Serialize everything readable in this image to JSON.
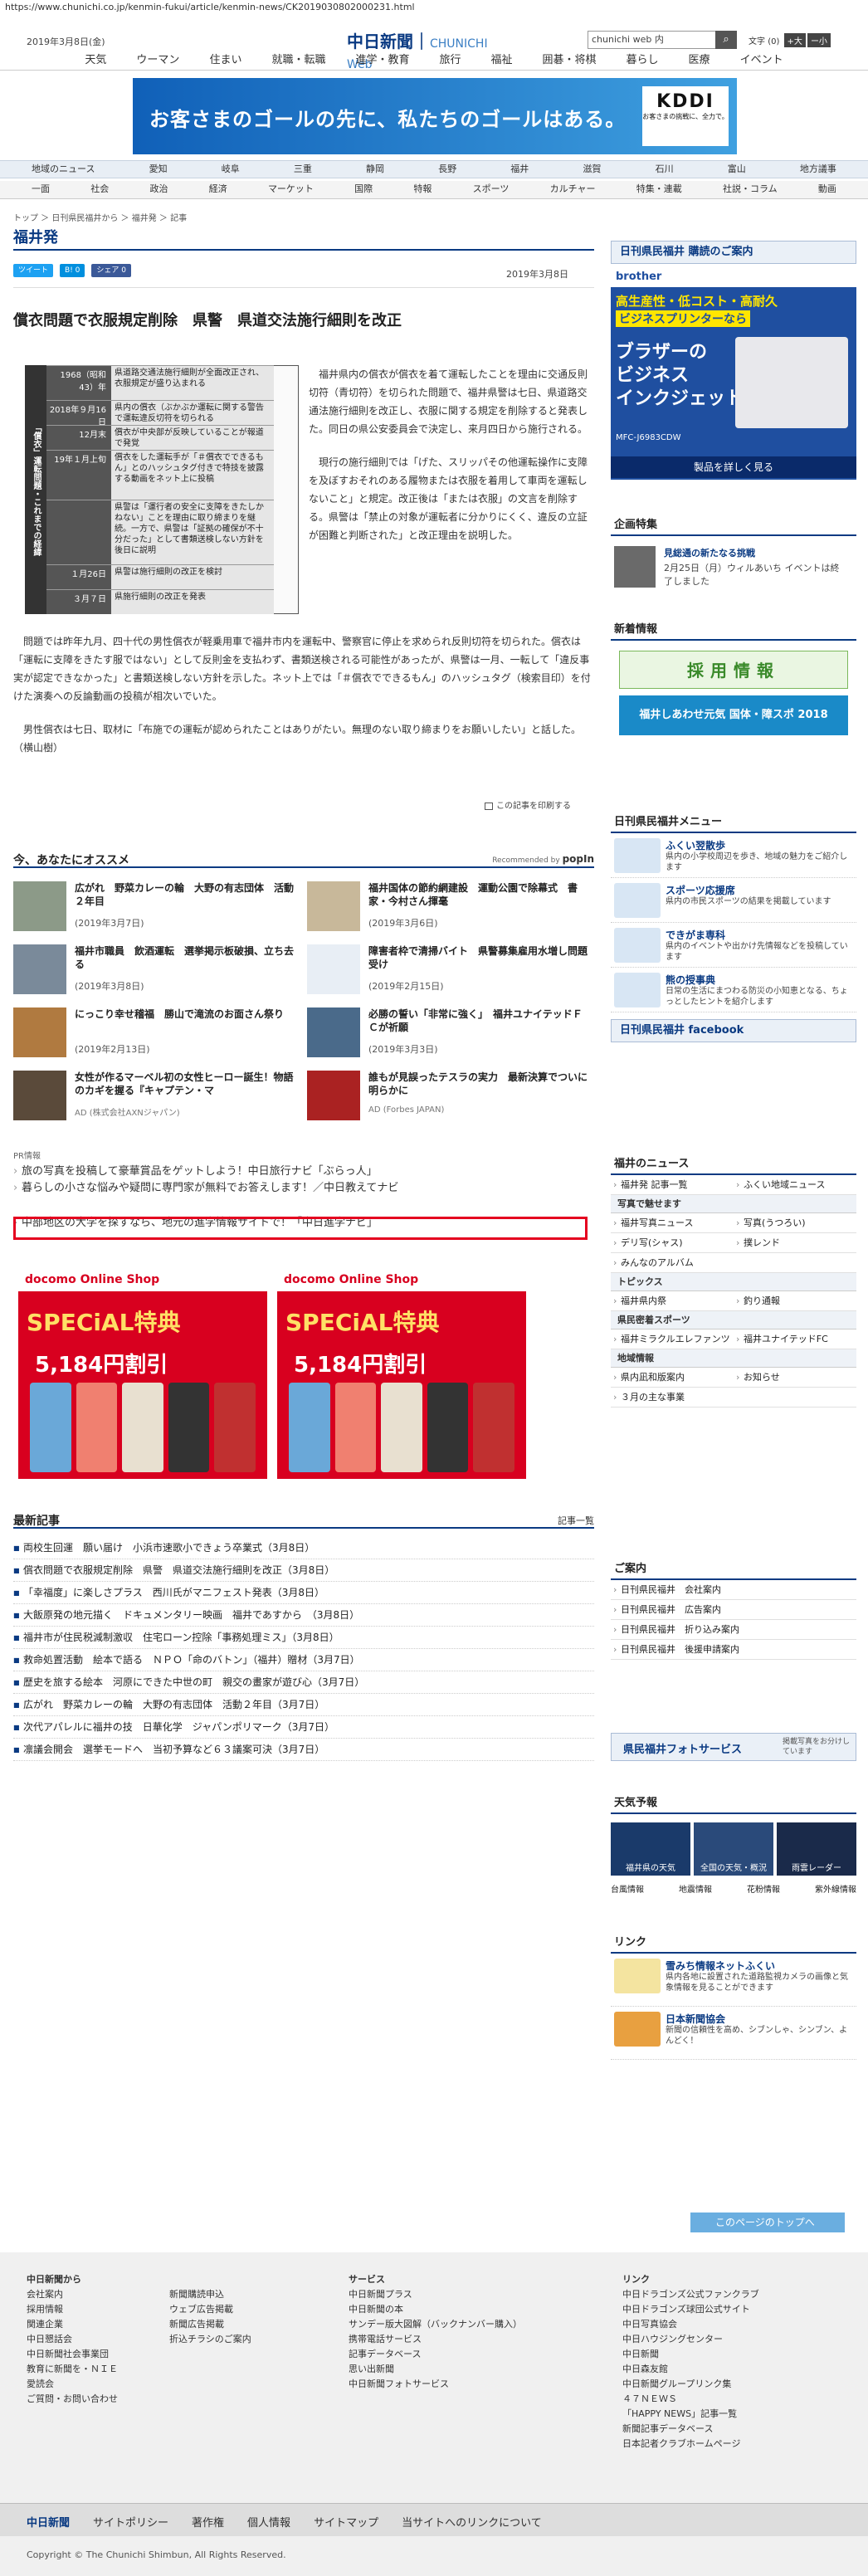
{
  "browser": {
    "url": "https://www.chunichi.co.jp/kenmin-fukui/article/kenmin-news/CK2019030802000231.html"
  },
  "header": {
    "date": "2019年3月8日(金)",
    "logo_main": "中日新聞",
    "logo_sub": "CHUNICHI Web",
    "search_value": "chunichi web 内",
    "search_icon": "search-icon",
    "font_label": "文字",
    "font_reset": "(0)",
    "font_plus": "+大",
    "font_minus": "ー小"
  },
  "nav1": [
    "天気",
    "ウーマン",
    "住まい",
    "就職・転職",
    "進学・教育",
    "旅行",
    "福祉",
    "囲碁・将棋",
    "暮らし",
    "医療",
    "イベント"
  ],
  "ad_top": {
    "text": "お客さまのゴールの先に、私たちのゴールはある。",
    "brand": "KDDI",
    "brand_sub": "お客さまの挑戦に、全力で。"
  },
  "nav2": [
    "地域のニュース",
    "愛知",
    "岐阜",
    "三重",
    "静岡",
    "長野",
    "福井",
    "滋賀",
    "石川",
    "富山",
    "地方議事"
  ],
  "nav3": [
    "一面",
    "社会",
    "政治",
    "経済",
    "マーケット",
    "国際",
    "特報",
    "スポーツ",
    "カルチャー",
    "特集・連載",
    "社説・コラム",
    "動画"
  ],
  "breadcrumb": "トップ ＞ 日刊県民福井から ＞ 福井発 ＞ 記事",
  "section_title": "福井発",
  "social": {
    "tweet": "ツイート",
    "hatena": "B! 0",
    "share": "シェア 0"
  },
  "article": {
    "date": "2019年3月8日",
    "headline": "償衣問題で衣服規定削除　県警　県道交法施行細則を改正",
    "timeline_title": "「償衣」運転問題・これまでの経緯",
    "timeline": [
      {
        "date": "1968（昭和43）年",
        "text": "県道路交通法施行細則が全面改正され、衣服規定が盛り込まれる"
      },
      {
        "date": "2018年９月16日",
        "text": "県内の償衣（ぶかぶか運転に関する警告で運転違反切符を切られる"
      },
      {
        "date": "12月末",
        "text": "償衣が中央部が反映していることが報道で発覚"
      },
      {
        "date": "19年１月上旬",
        "text": "償衣をした運転手が「＃償衣でできるもん」とのハッシュタグ付きで特技を披露する動画をネット上に投稿"
      },
      {
        "date": "",
        "text": "県警は「運行者の安全に支障をきたしかねない」ことを理由に取り締まりを継続。一方で、県警は「証拠の確保が不十分だった」として書類送検しない方針を後日に説明"
      },
      {
        "date": "１月26日",
        "text": "県警は施行細則の改正を検討"
      },
      {
        "date": "３月７日",
        "text": "県施行細則の改正を発表"
      }
    ],
    "paragraphs": [
      "福井県内の償衣が償衣を着て運転したことを理由に交通反則切符（青切符）を切られた問題で、福井県警は七日、県道路交通法施行細則を改正し、衣服に関する規定を削除すると発表した。同日の県公安委員会で決定し、来月四日から施行される。",
      "現行の施行細則では「げた、スリッパその他運転操作に支障を及ぼすおそれのある履物または衣服を着用して車両を運転しないこと」と規定。改正後は「または衣服」の文言を削除する。県警は「禁止の対象が運転者に分かりにくく、違反の立証が困難と判断された」と改正理由を説明した。",
      "問題では昨年九月、四十代の男性償衣が軽乗用車で福井市内を運転中、警察官に停止を求められ反則切符を切られた。償衣は「運転に支障をきたす服ではない」として反則金を支払わず、書類送検される可能性があったが、県警は一月、一転して「違反事実が認定できなかった」と書類送検しない方針を示した。ネット上では「＃償衣でできるもん」のハッシュタグ（検索目印）を付けた演奏への反論動画の投稿が相次いでいた。",
      "男性償衣は七日、取材に「布施での運転が認められたことはありがたい。無理のない取り締まりをお願いしたい」と話した。　（横山樹）"
    ],
    "print_label": "この記事を印刷する"
  },
  "recommend": {
    "title": "今、あなたにオススメ",
    "powered": "Recommended by",
    "brand": "popIn",
    "items": [
      {
        "text": "広がれ　野菜カレーの輪　大野の有志団体　活動２年目",
        "date": "(2019年3月7日)"
      },
      {
        "text": "福井国体の節約網建設　運動公園で除幕式　書家・今村さん揮毫",
        "date": "(2019年3月6日)"
      },
      {
        "text": "福井市職員　飲酒運転　選挙掲示板破損、立ち去る",
        "date": "(2019年3月8日)"
      },
      {
        "text": "障害者枠で清掃バイト　県警募集雇用水増し問題受け",
        "date": "(2019年2月15日)"
      },
      {
        "text": "にっこり幸せ稽福　勝山で滝流のお面さん祭り",
        "date": "(2019年2月13日)"
      },
      {
        "text": "必勝の誓い「非常に強く」　福井ユナイテッドＦＣが祈願",
        "date": "(2019年3月3日)"
      },
      {
        "text": "女性が作るマーベル初の女性ヒーロー誕生！物語のカギを握る『キャプテン・マ",
        "date": "AD (株式会社AXNジャパン)"
      },
      {
        "text": "誰もが見誤ったテスラの実力　最新決算でついに明らかに",
        "date": "AD (Forbes JAPAN)"
      }
    ]
  },
  "pr": {
    "label": "PR情報",
    "items": [
      "旅の写真を投稿して豪華賞品をゲットしよう！中日旅行ナビ「ぶらっ人」",
      "暮らしの小さな悩みや疑問に専門家が無料でお答えします！／中日教えてナビ",
      "中部地区の大学を探すなら、地元の進学情報サイトで！「中日進学ナビ」"
    ]
  },
  "docomo": {
    "brand": "docomo Online Shop",
    "big": "SPECiAL特典",
    "price": "5,184円割引"
  },
  "latest": {
    "title": "最新記事",
    "more": "記事一覧",
    "items": [
      "両校生回運　願い届け　小浜市速歌小できょう卒業式（3月8日）",
      "償衣問題で衣服規定削除　県警　県道交法施行細則を改正（3月8日）",
      "「幸福度」に楽しさプラス　西川氏がマニフェスト発表（3月8日）",
      "大飯原発の地元描く　ドキュメンタリー映画　福井であすから　（3月8日）",
      "福井市が住民税減制激収　住宅ローン控除「事務処理ミス」（3月8日）",
      "救命処置活動　絵本で語る　ＮＰＯ「命のバトン」（福井）贈材（3月7日）",
      "歴史を旅する絵本　河原にできた中世の町　親交の畫家が遊び心（3月7日）",
      "広がれ　野菜カレーの輪　大野の有志団体　活動２年目（3月7日）",
      "次代アパレルに福井の技　日華化学　ジャパンポリマーク（3月7日）",
      "凛議会開会　選挙モードへ　当初予算など６３議案可決（3月7日）"
    ]
  },
  "sidebar": {
    "subscribe": "日刊県民福井 購読のご案内",
    "brother": {
      "brand": "brother",
      "line1": "高生産性・低コスト・高耐久",
      "line2": "ビジネスプリンターなら",
      "line3": "ブラザーの",
      "line4": "ビジネス",
      "line5": "インクジェット",
      "model": "MFC-J6983CDW",
      "more": "製品を詳しく見る"
    },
    "feature": {
      "title": "企画特集",
      "item_title": "見総通の新たなる挑戦",
      "item_text": "2月25日（月）ウィルあいち イベントは終了しました"
    },
    "jobs": {
      "title": "新着情報",
      "banner1": "採用情報",
      "banner2": "福井しあわせ元気 国体・障スポ 2018"
    },
    "menu": {
      "title": "日刊県民福井メニュー",
      "items": [
        {
          "t": "ふくい翌散歩",
          "d": "県内の小学校周辺を歩き、地域の魅力をご紹介します"
        },
        {
          "t": "スポーツ応援席",
          "d": "県内の市民スポーツの結果を掲載しています"
        },
        {
          "t": "できがま専科",
          "d": "県内のイベントや出かけ先情報などを投稿しています"
        },
        {
          "t": "熊の授事典",
          "d": "日常の生活にまつわる防災の小知恵となる、ちょっとしたヒントを紹介します"
        }
      ],
      "facebook": "日刊県民福井 facebook"
    },
    "news": {
      "title": "福井のニュース",
      "rows": [
        [
          "福井発 記事一覧",
          "ふくい地域ニュース"
        ]
      ],
      "sections": [
        {
          "h": "写真で魅せます",
          "rows": [
            [
              "福井写真ニュース",
              "写真(うつろい)"
            ],
            [
              "デリ写(シャス)",
              "撲レンド"
            ],
            [
              "みんなのアルバム",
              ""
            ]
          ]
        },
        {
          "h": "トピックス",
          "rows": [
            [
              "福井県内祭",
              "釣り通報"
            ]
          ]
        },
        {
          "h": "県民密着スポーツ",
          "rows": [
            [
              "福井ミラクルエレファンツ",
              "福井ユナイテッドFC"
            ]
          ]
        },
        {
          "h": "地域情報",
          "rows": [
            [
              "県内凪和版案内",
              "お知らせ"
            ],
            [
              "３月の主な事業",
              ""
            ]
          ]
        }
      ]
    },
    "guide": {
      "title": "ご案内",
      "rows": [
        [
          "日刊県民福井　会社案内",
          ""
        ],
        [
          "日刊県民福井　広告案内",
          ""
        ],
        [
          "日刊県民福井　折り込み案内",
          ""
        ],
        [
          "日刊県民福井　後援申請案内",
          ""
        ]
      ]
    },
    "photo": "県民福井フォトサービス",
    "photo_sub": "掲載写真をお分けしています",
    "weather": {
      "title": "天気予報",
      "tiles": [
        "福井県の天気",
        "全国の天気・概況",
        "雨雲レーダー"
      ],
      "links": [
        "台風情報",
        "地震情報",
        "花粉情報",
        "紫外線情報"
      ]
    },
    "links": {
      "title": "リンク",
      "items": [
        {
          "t": "雪みち情報ネットふくい",
          "d": "県内各地に設置された道路監視カメラの画像と気象情報を見ることができます"
        },
        {
          "t": "日本新聞協会",
          "d": "新聞の信頼性を高め、シブンしゃ、シンブン、よんどく！"
        }
      ]
    }
  },
  "pagetop": "このページのトップへ",
  "footer": {
    "col1_title": "中日新聞から",
    "col1": [
      "会社案内",
      "採用情報",
      "関連企業",
      "中日懇話会",
      "中日新聞社会事業団",
      "教育に新聞を・ＮＩＥ",
      "愛読会",
      "ご質問・お問い合わせ"
    ],
    "col2": [
      "新聞購読申込",
      "ウェブ広告掲載",
      "新聞広告掲載",
      "折込チラシのご案内"
    ],
    "col3_title": "サービス",
    "col3": [
      "中日新聞プラス",
      "中日新聞の本",
      "サンデー版大図解（バックナンバー購入）",
      "携帯電話サービス",
      "記事データベース",
      "思い出新聞",
      "中日新聞フォトサービス"
    ],
    "col4_title": "リンク",
    "col4": [
      "中日ドラゴンズ公式ファンクラブ",
      "中日ドラゴンズ球団公式サイト",
      "中日写真協会",
      "中日ハウジングセンター",
      "中日新聞",
      "中日森友館",
      "中日新聞グループリンク集",
      "４７ＮＥＷＳ",
      "「HAPPY NEWS」記事一覧",
      "新聞記事データベース",
      "日本記者クラブホームページ"
    ],
    "bar": [
      "中日新聞",
      "サイトポリシー",
      "著作権",
      "個人情報",
      "サイトマップ",
      "当サイトへのリンクについて"
    ],
    "copyright": "Copyright © The Chunichi Shimbun, All Rights Reserved."
  }
}
